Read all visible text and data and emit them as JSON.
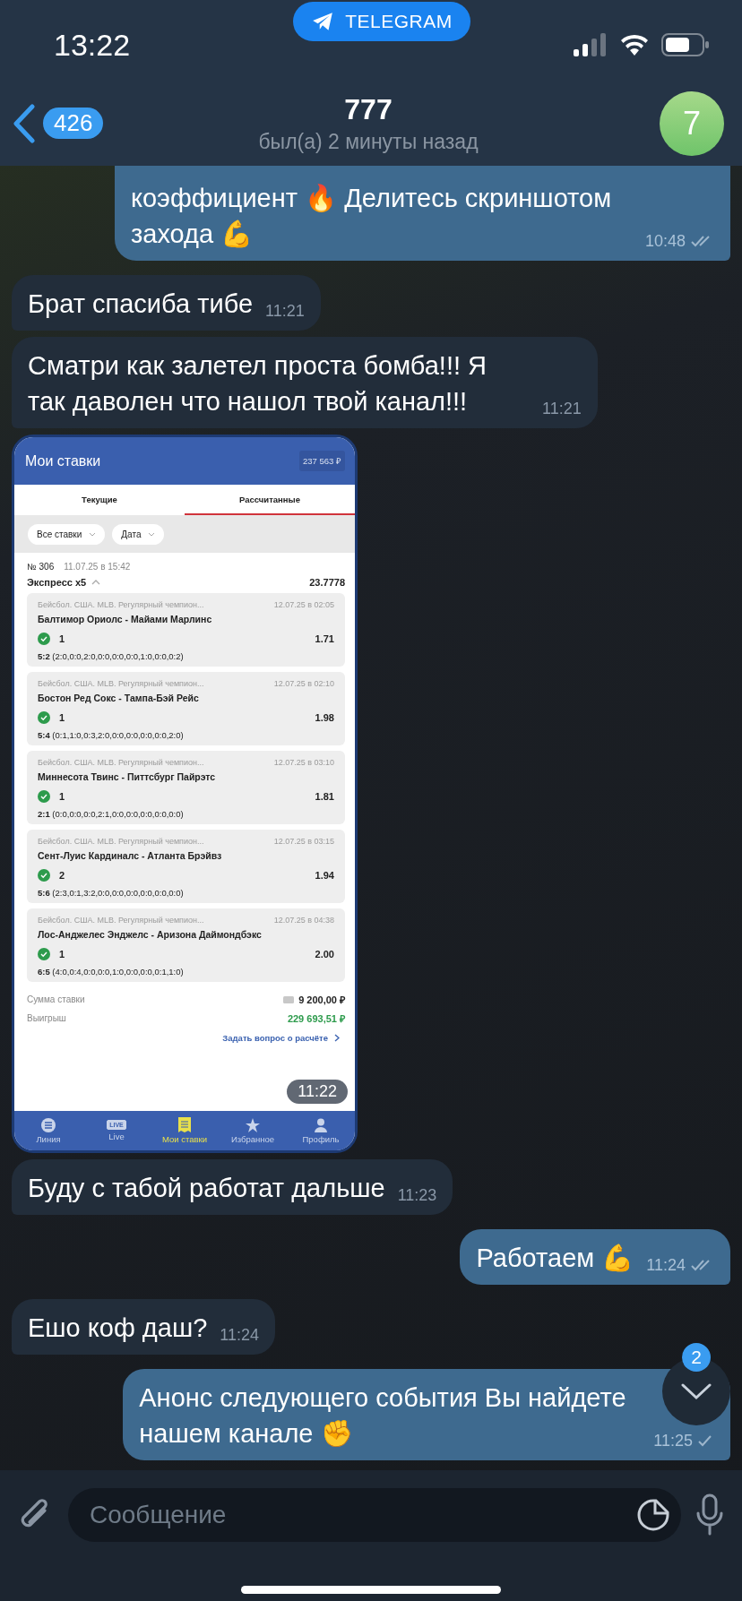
{
  "status_bar": {
    "time": "13:22",
    "app_pill": "TELEGRAM"
  },
  "header": {
    "unread": "426",
    "title": "777",
    "subtitle": "был(а) 2 минуты назад",
    "avatar_text": "7"
  },
  "messages": [
    {
      "kind": "text",
      "outgoing": true,
      "text": "коэффициент 🔥 Делитесь скриншотом захода 💪",
      "time": "10:48",
      "read": true
    },
    {
      "kind": "text",
      "outgoing": false,
      "text": "Брат спасиба тибе",
      "time": "11:21"
    },
    {
      "kind": "text",
      "outgoing": false,
      "text": "Сматри как залетел проста бомба!!! Я так даволен что нашол твой канал!!!",
      "time": "11:21"
    },
    {
      "kind": "image",
      "outgoing": false,
      "time": "11:22",
      "screenshot": {
        "title": "Мои ставки",
        "balance": "237 563 ₽",
        "tabs": [
          {
            "label": "Текущие",
            "selected": false
          },
          {
            "label": "Рассчитанные",
            "selected": true
          }
        ],
        "filters": [
          "Все ставки",
          "Дата"
        ],
        "bet": {
          "number": "№ 306",
          "date": "11.07.25 в 15:42",
          "type": "Экспресс x5",
          "odds": "23.7778",
          "events": [
            {
              "league": "Бейсбол. США. MLB. Регулярный чемпион...",
              "date": "12.07.25 в 02:05",
              "match": "Балтимор Ориолс - Майами Марлинс",
              "won": true,
              "pick": "1",
              "odds": "1.71",
              "score": "**5:2** (2:0,0:0,2:0,0:0,0:0,0:0,1:0,0:0,0:2)"
            },
            {
              "league": "Бейсбол. США. MLB. Регулярный чемпион...",
              "date": "12.07.25 в 02:10",
              "match": "Бостон Ред Сокс - Тампа-Бэй Рейс",
              "won": true,
              "pick": "1",
              "odds": "1.98",
              "score": "**5:4** (0:1,1:0,0:3,2:0,0:0,0:0,0:0,0:0,2:0)"
            },
            {
              "league": "Бейсбол. США. MLB. Регулярный чемпион...",
              "date": "12.07.25 в 03:10",
              "match": "Миннесота Твинс - Питтсбург Пайрэтс",
              "won": true,
              "pick": "1",
              "odds": "1.81",
              "score": "**2:1** (0:0,0:0,0:0,2:1,0:0,0:0,0:0,0:0,0:0)"
            },
            {
              "league": "Бейсбол. США. MLB. Регулярный чемпион...",
              "date": "12.07.25 в 03:15",
              "match": "Сент-Луис Кардиналс - Атланта Брэйвз",
              "won": true,
              "pick": "2",
              "odds": "1.94",
              "score": "**5:6** (2:3,0:1,3:2,0:0,0:0,0:0,0:0,0:0,0:0)"
            },
            {
              "league": "Бейсбол. США. MLB. Регулярный чемпион...",
              "date": "12.07.25 в 04:38",
              "match": "Лос-Анджелес Энджелс - Аризона Даймондбэкс",
              "won": true,
              "pick": "1",
              "odds": "2.00",
              "score": "**6:5** (4:0,0:4,0:0,0:0,1:0,0:0,0:0,0:1,1:0)"
            }
          ]
        },
        "stake_label": "Сумма ставки",
        "stake": "9 200,00 ₽",
        "win_label": "Выигрыш",
        "win": "229 693,51 ₽",
        "link": "Задать вопрос о расчёте",
        "nav": [
          {
            "label": "Линия",
            "selected": false
          },
          {
            "label": "Live",
            "selected": false
          },
          {
            "label": "Мои ставки",
            "selected": true
          },
          {
            "label": "Избранное",
            "selected": false
          },
          {
            "label": "Профиль",
            "selected": false
          }
        ],
        "nav_live_badge": "LIVE"
      }
    },
    {
      "kind": "text",
      "outgoing": false,
      "text": "Буду с табой работат дальше",
      "time": "11:23"
    },
    {
      "kind": "text",
      "outgoing": true,
      "text": "Работаем 💪",
      "time": "11:24",
      "read": true
    },
    {
      "kind": "text",
      "outgoing": false,
      "text": "Ешо коф даш?",
      "time": "11:24"
    },
    {
      "kind": "text",
      "outgoing": true,
      "text": "Анонс следующего события Вы найдете нашем канале ✊",
      "time": "11:25",
      "read": false
    }
  ],
  "scroll_down": {
    "badge": "2"
  },
  "composer": {
    "placeholder": "Сообщение"
  }
}
